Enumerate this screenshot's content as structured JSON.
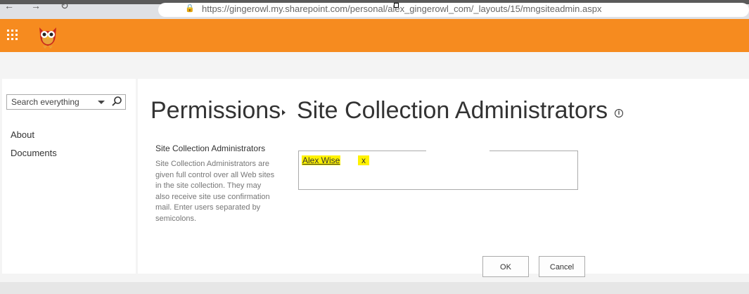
{
  "browser": {
    "url": "https://gingerowl.my.sharepoint.com/personal/alex_gingerowl_com/_layouts/15/mngsiteadmin.aspx",
    "back_glyph": "←",
    "forward_glyph": "→",
    "refresh_glyph": "↻",
    "lock_glyph": "🔒"
  },
  "suite_bar": {
    "color": "#f68b1f",
    "logo_icon": "owl-logo"
  },
  "search": {
    "placeholder": "Search everything"
  },
  "left_nav": {
    "items": [
      {
        "label": "About"
      },
      {
        "label": "Documents"
      }
    ]
  },
  "breadcrumb": {
    "parent": "Permissions",
    "current": "Site Collection Administrators"
  },
  "section": {
    "label": "Site Collection Administrators",
    "description": "Site Collection Administrators are given full control over all Web sites in the site collection. They may also receive site use confirmation mail. Enter users separated by semicolons."
  },
  "people_picker": {
    "users": [
      {
        "name": "Alex Wise",
        "remove_label": "x"
      }
    ],
    "highlight_color": "#fff200"
  },
  "buttons": {
    "ok": "OK",
    "cancel": "Cancel"
  }
}
